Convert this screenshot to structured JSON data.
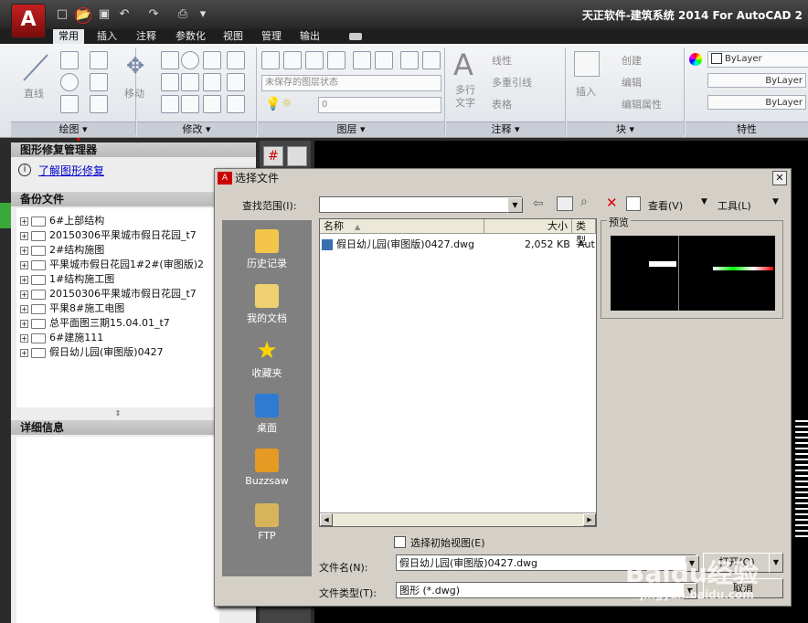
{
  "window": {
    "title": "天正软件-建筑系统 2014 For AutoCAD 2",
    "logo_letter": "A"
  },
  "tabs": [
    "常用",
    "插入",
    "注释",
    "参数化",
    "视图",
    "管理",
    "输出"
  ],
  "ribbon": {
    "draw_panel": {
      "title": "绘图 ▾",
      "line_label": "直线"
    },
    "modify_panel": {
      "title": "修改 ▾",
      "move_label": "移动"
    },
    "layers_panel": {
      "title": "图层 ▾",
      "state_combo": "未保存的图层状态",
      "layer_combo": "0"
    },
    "annotation_panel": {
      "title": "注释 ▾",
      "text_label": "多行\n文字",
      "linear": "线性",
      "multileader": "多重引线",
      "table": "表格"
    },
    "block_panel": {
      "title": "块 ▾",
      "insert": "插入",
      "create": "创建",
      "edit": "编辑",
      "edit_attr": "编辑属性"
    },
    "properties_panel": {
      "title": "特性",
      "color": "ByLayer",
      "linetype": "ByLayer",
      "lineweight": "ByLayer"
    }
  },
  "recovery_panel": {
    "header": "图形修复管理器",
    "learn_link": "了解图形修复",
    "backup_header": "备份文件",
    "backup_files": [
      "6#上部结构",
      "20150306平果城市假日花园_t7",
      "2#结构施图",
      "平果城市假日花园1#2#(审图版)2",
      "1#结构施工图",
      "20150306平果城市假日花园_t7",
      "平果8#施工电图",
      "总平面图三期15.04.01_t7",
      "6#建施111",
      "假日幼儿园(审图版)0427"
    ],
    "details_header": "详细信息"
  },
  "dialog": {
    "title": "选择文件",
    "lookin_label": "查找范围(I):",
    "lookin_value": "",
    "toolbar": {
      "view_label": "查看(V)",
      "tools_label": "工具(L)"
    },
    "places": [
      "历史记录",
      "我的文档",
      "收藏夹",
      "桌面",
      "Buzzsaw",
      "FTP"
    ],
    "columns": {
      "name": "名称",
      "size": "大小",
      "type": "类型"
    },
    "files": [
      {
        "name": "假日幼儿园(审图版)0427.dwg",
        "size": "2,052 KB",
        "type": "Aut"
      }
    ],
    "preview_label": "预览",
    "initial_view_label": "选择初始视图(E)",
    "filename_label": "文件名(N):",
    "filename_value": "假日幼儿园(审图版)0427.dwg",
    "filetype_label": "文件类型(T):",
    "filetype_value": "图形 (*.dwg)",
    "open_button": "打开(O)",
    "cancel_button": "取消"
  },
  "watermark": {
    "text": "Baidu经验",
    "url": "jingyan.baidu.com"
  }
}
